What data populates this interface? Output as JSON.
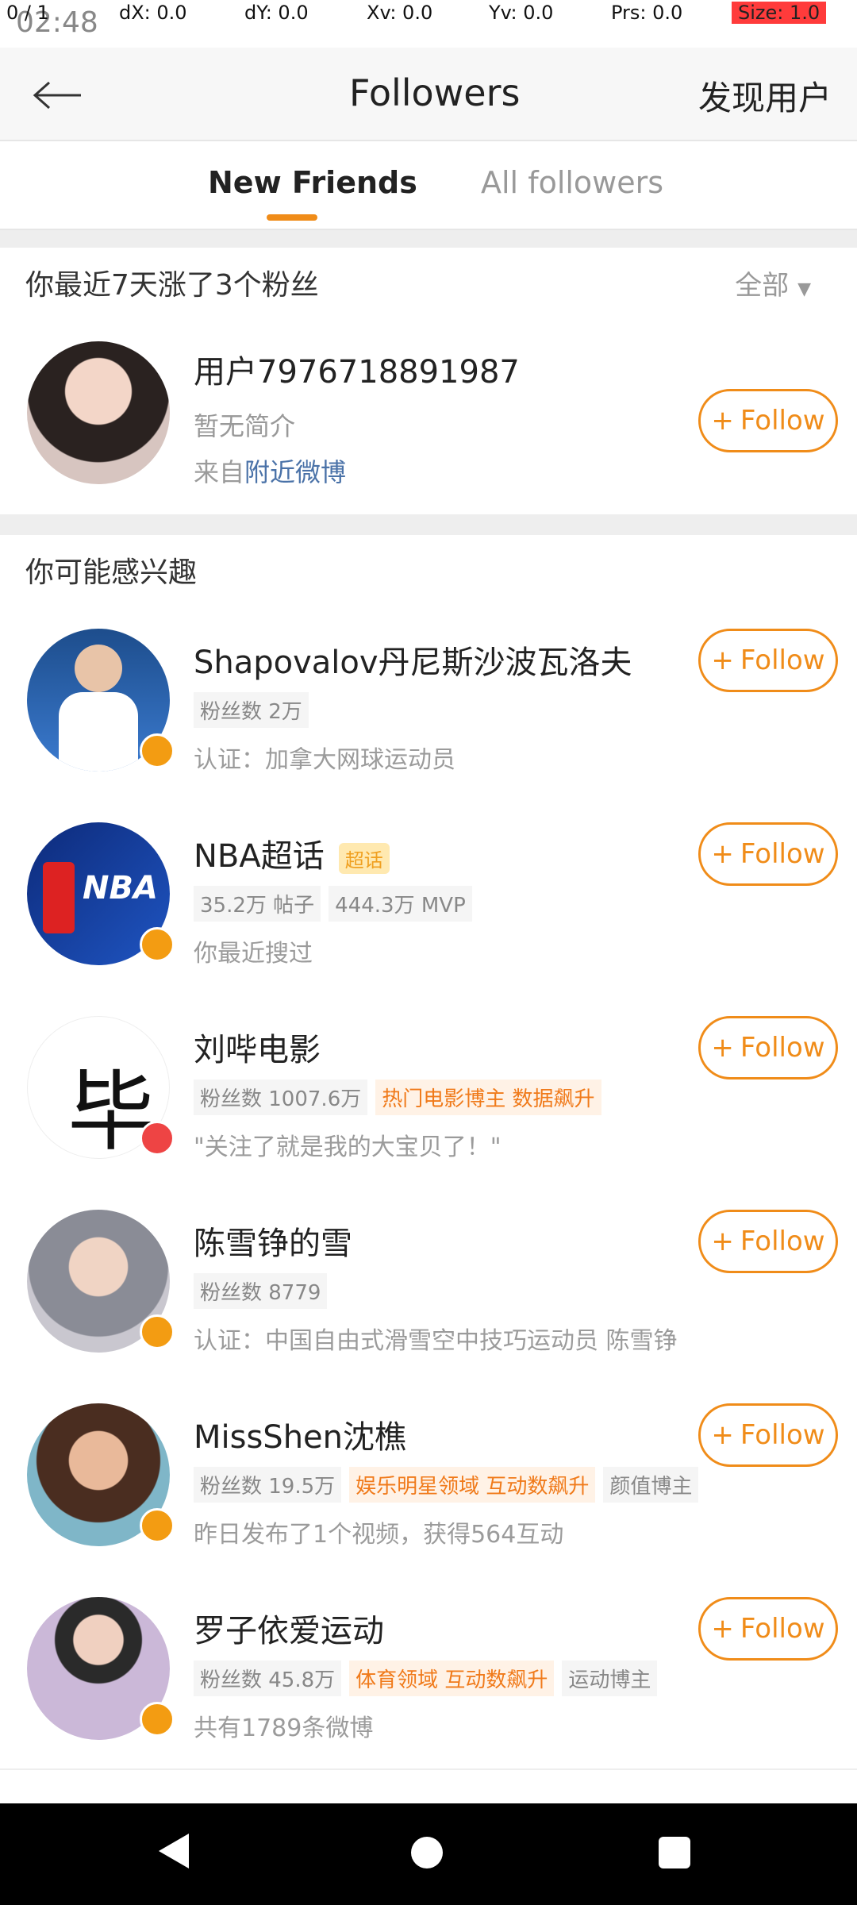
{
  "status": {
    "time": "02:48"
  },
  "debug": {
    "pointer": "0 / 1",
    "dx": "dX: 0.0",
    "dy": "dY: 0.0",
    "xv": "Xv: 0.0",
    "yv": "Yv: 0.0",
    "prs": "Prs: 0.0",
    "size": "Size: 1.0"
  },
  "header": {
    "title": "Followers",
    "discover": "发现用户"
  },
  "tabs": [
    {
      "label": "New Friends"
    },
    {
      "label": "All followers"
    }
  ],
  "recent": {
    "text": "你最近7天涨了3个粉丝",
    "filter": "全部"
  },
  "new_follower": {
    "name": "用户7976718891987",
    "intro": "暂无简介",
    "source_prefix": "来自",
    "source_link": "附近微博",
    "follow": "Follow"
  },
  "suggest": {
    "title": "你可能感兴趣"
  },
  "users": [
    {
      "name": "Shapovalov丹尼斯沙波瓦洛夫",
      "chips": [
        "粉丝数 2万"
      ],
      "sub": "认证：加拿大网球运动员",
      "follow": "Follow"
    },
    {
      "name": "NBA超话",
      "super": "超话",
      "chips": [
        "35.2万 帖子",
        "444.3万 MVP"
      ],
      "sub": "你最近搜过",
      "follow": "Follow"
    },
    {
      "name": "刘哔电影",
      "chips": [
        "粉丝数 1007.6万"
      ],
      "hot": "热门电影博主 数据飙升",
      "sub": "\"关注了就是我的大宝贝了！\"",
      "follow": "Follow"
    },
    {
      "name": "陈雪铮的雪",
      "chips": [
        "粉丝数 8779"
      ],
      "sub": "认证：中国自由式滑雪空中技巧运动员 陈雪铮",
      "follow": "Follow"
    },
    {
      "name": "MissShen沈樵",
      "chips": [
        "粉丝数 19.5万"
      ],
      "hot": "娱乐明星领域 互动数飙升",
      "chip2": "颜值博主",
      "sub": "昨日发布了1个视频，获得564互动",
      "follow": "Follow"
    },
    {
      "name": "罗子依爱运动",
      "chips": [
        "粉丝数 45.8万"
      ],
      "hot": "体育领域 互动数飙升",
      "chip2": "运动博主",
      "sub": "共有1789条微博",
      "follow": "Follow"
    }
  ],
  "colors": {
    "accent": "#f08c19",
    "outline": "#31e331",
    "link": "#4a72a8"
  }
}
